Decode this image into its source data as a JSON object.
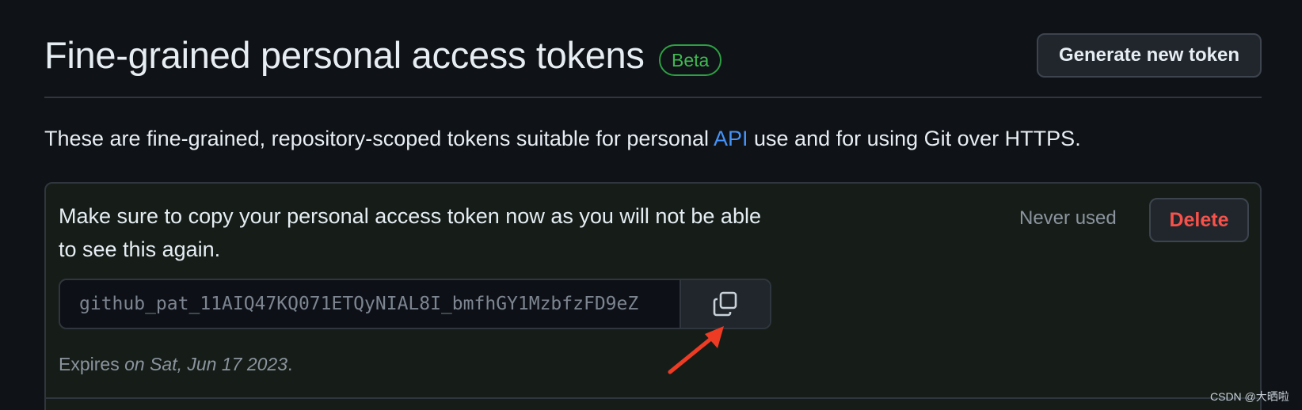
{
  "header": {
    "title": "Fine-grained personal access tokens",
    "badge": "Beta",
    "generate_button": "Generate new token"
  },
  "description": {
    "before": "These are fine-grained, repository-scoped tokens suitable for personal ",
    "link": "API",
    "after": " use and for using Git over HTTPS."
  },
  "token_panel": {
    "notice": "Make sure to copy your personal access token now as you will not be able to see this again.",
    "status": "Never used",
    "delete_button": "Delete",
    "token_value": "github_pat_11AIQ47KQ071ETQyNIAL8I_bmfhGY1MzbfzFD9eZ",
    "copy_icon": "copy-icon",
    "expires_prefix": "Expires ",
    "expires_date": "on Sat, Jun 17 2023",
    "expires_suffix": "."
  },
  "annotation": {
    "arrow_color": "#ee3b24"
  },
  "watermark": "CSDN @大晒啦",
  "colors": {
    "background": "#0f1217",
    "accent_green": "#3fb950",
    "link_blue": "#4493f8",
    "danger_red": "#f85149"
  }
}
